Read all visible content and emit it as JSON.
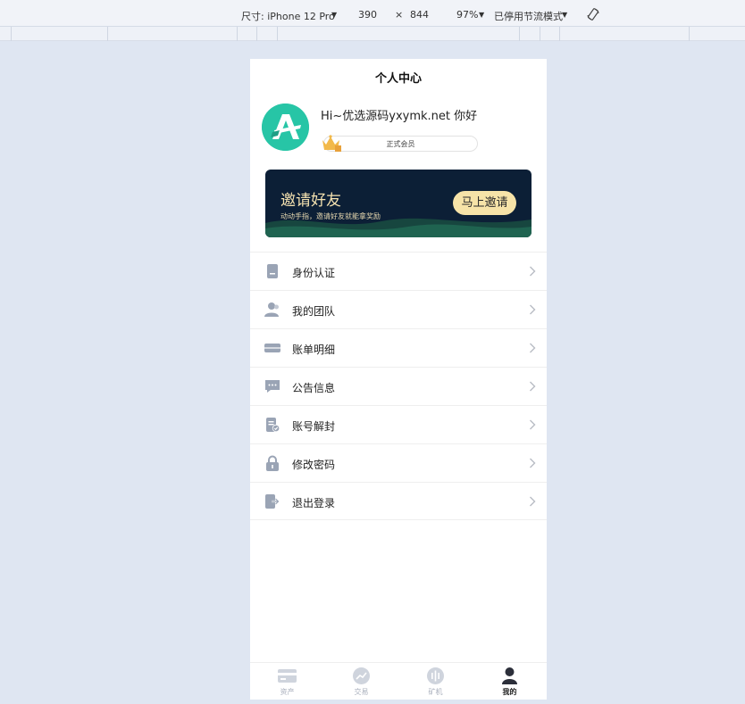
{
  "devtools": {
    "device": "尺寸: iPhone 12 Pro",
    "width": "390",
    "times": "×",
    "height": "844",
    "zoom": "97%",
    "throttle": "已停用节流模式"
  },
  "page": {
    "title": "个人中心"
  },
  "profile": {
    "greeting": "Hi~优选源码yxymk.net 你好",
    "membership": "正式会员"
  },
  "banner": {
    "title": "邀请好友",
    "subtitle": "动动手指，邀请好友就能拿奖励",
    "button": "马上邀请"
  },
  "menu": [
    {
      "label": "身份认证",
      "icon": "id-card-icon"
    },
    {
      "label": "我的团队",
      "icon": "team-icon"
    },
    {
      "label": "账单明细",
      "icon": "bill-icon"
    },
    {
      "label": "公告信息",
      "icon": "message-icon"
    },
    {
      "label": "账号解封",
      "icon": "unlock-document-icon"
    },
    {
      "label": "修改密码",
      "icon": "lock-icon"
    },
    {
      "label": "退出登录",
      "icon": "logout-icon"
    }
  ],
  "tabs": [
    {
      "label": "资产",
      "icon": "wallet-icon",
      "active": false
    },
    {
      "label": "交易",
      "icon": "trade-icon",
      "active": false
    },
    {
      "label": "矿机",
      "icon": "miner-icon",
      "active": false
    },
    {
      "label": "我的",
      "icon": "user-icon",
      "active": true
    }
  ],
  "colors": {
    "accent": "#27c5a6",
    "banner_bg": "#0c1f36",
    "banner_button": "#f6e3a8",
    "icon_gray": "#9aa4b5"
  }
}
